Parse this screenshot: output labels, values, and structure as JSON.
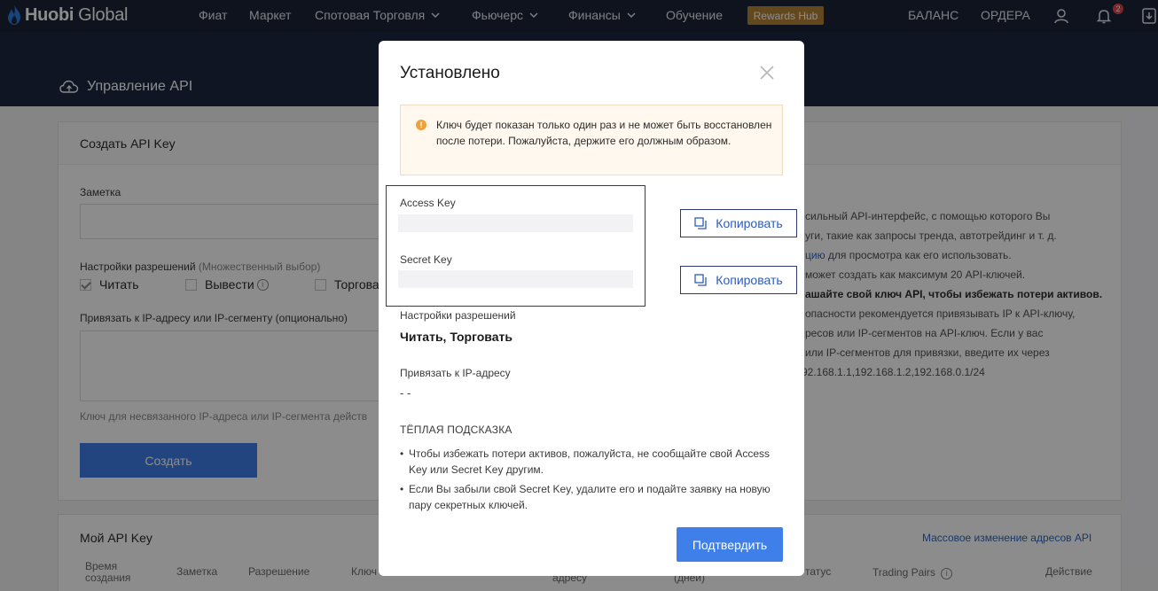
{
  "nav": {
    "logo_part1": "Huobi",
    "logo_part2": "Global",
    "items": [
      "Фиат",
      "Маркет",
      "Спотовая Торговля",
      "Фьючерс",
      "Финансы",
      "Обучение"
    ],
    "rewards": "Rewards Hub",
    "balance": "БАЛАНС",
    "orders": "ОРДЕРА",
    "notif_count": "2"
  },
  "header": {
    "title": "Управление API"
  },
  "create": {
    "title": "Создать API Key",
    "note_label": "Заметка",
    "perm_label": "Настройки разрешений",
    "perm_hint": "(Множественный выбор)",
    "perm_read": "Читать",
    "perm_withdraw": "Вывести",
    "perm_trade": "Торговать",
    "ip_label": "Привязать к IP-адресу или IP-сегменту (опционально)",
    "ip_hint": "Ключ для несвязанного IP-адреса или IP-сегмента действ",
    "create_button": "Создать",
    "side": [
      "сильный API-интерфейс, с помощью которого Вы",
      "уги, такие как запросы тренда, автотрейдинг и т. д.",
      "для просмотра как его использовать.",
      "может создать как максимум 20 API-ключей.",
      "ашайте свой ключ API, чтобы избежать потери активов.",
      "опасности рекомендуется привязывать IP к API-ключу,",
      "ресов или IP-сегментов на API-ключ. Если у вас",
      "или IP-сегментов для привязки, введите их через",
      "92.168.1.1,192.168.1.2,192.168.0.1/24"
    ],
    "side_link": "цию"
  },
  "my_api": {
    "title": "Мой API Key",
    "bulk_link": "Массовое изменение адресов API",
    "columns": [
      "Время создания",
      "Заметка",
      "Разрешение",
      "Ключ",
      "адресу",
      "(дней)",
      "татус",
      "Trading Pairs",
      "Действие"
    ]
  },
  "modal": {
    "title": "Установлено",
    "warning": "Ключ будет показан только один раз и не может быть восстановлен после потери. Пожалуйста, держите его должным образом.",
    "access_key_label": "Access Key",
    "secret_key_label": "Secret Key",
    "copy_label": "Копировать",
    "perm_label": "Настройки разрешений",
    "perm_value": "Читать, Торговать",
    "ip_label": "Привязать к IP-адресу",
    "ip_value": "- -",
    "tips_title": "ТЁПЛАЯ ПОДСКАЗКА",
    "tips": [
      "Чтобы избежать потери активов, пожалуйста, не сообщайте свой Access Key или Secret Key другим.",
      "Если Вы забыли свой Secret Key, удалите его и подайте заявку на новую пару секретных ключей."
    ],
    "confirm": "Подтвердить"
  },
  "colors": {
    "nav_bg": "#1b2336",
    "primary": "#3f7fea",
    "rewards": "#b78335",
    "warning_bg": "#fff8ee",
    "warning_icon": "#eda23b"
  }
}
